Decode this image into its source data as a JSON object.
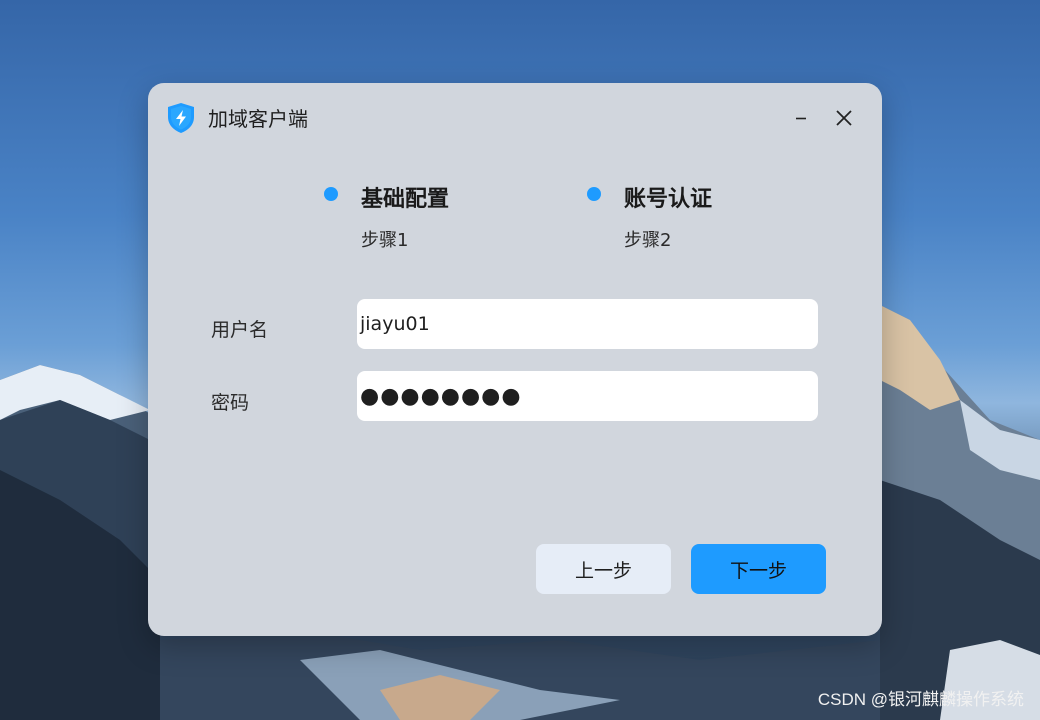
{
  "window": {
    "title": "加域客户端",
    "icon": "shield-lightning-icon"
  },
  "steps": [
    {
      "title": "基础配置",
      "subtitle": "步骤1",
      "status": "active"
    },
    {
      "title": "账号认证",
      "subtitle": "步骤2",
      "status": "active"
    }
  ],
  "form": {
    "username_label": "用户名",
    "username_value": "jiayu01",
    "password_label": "密码",
    "password_mask": "●●●●●●●●"
  },
  "buttons": {
    "prev_label": "上一步",
    "next_label": "下一步"
  },
  "watermark": "CSDN @银河麒麟操作系统",
  "colors": {
    "accent": "#1e9bff",
    "dialog_bg": "#d1d6dd",
    "secondary_button": "#e6edf7",
    "input_bg": "#ffffff"
  }
}
